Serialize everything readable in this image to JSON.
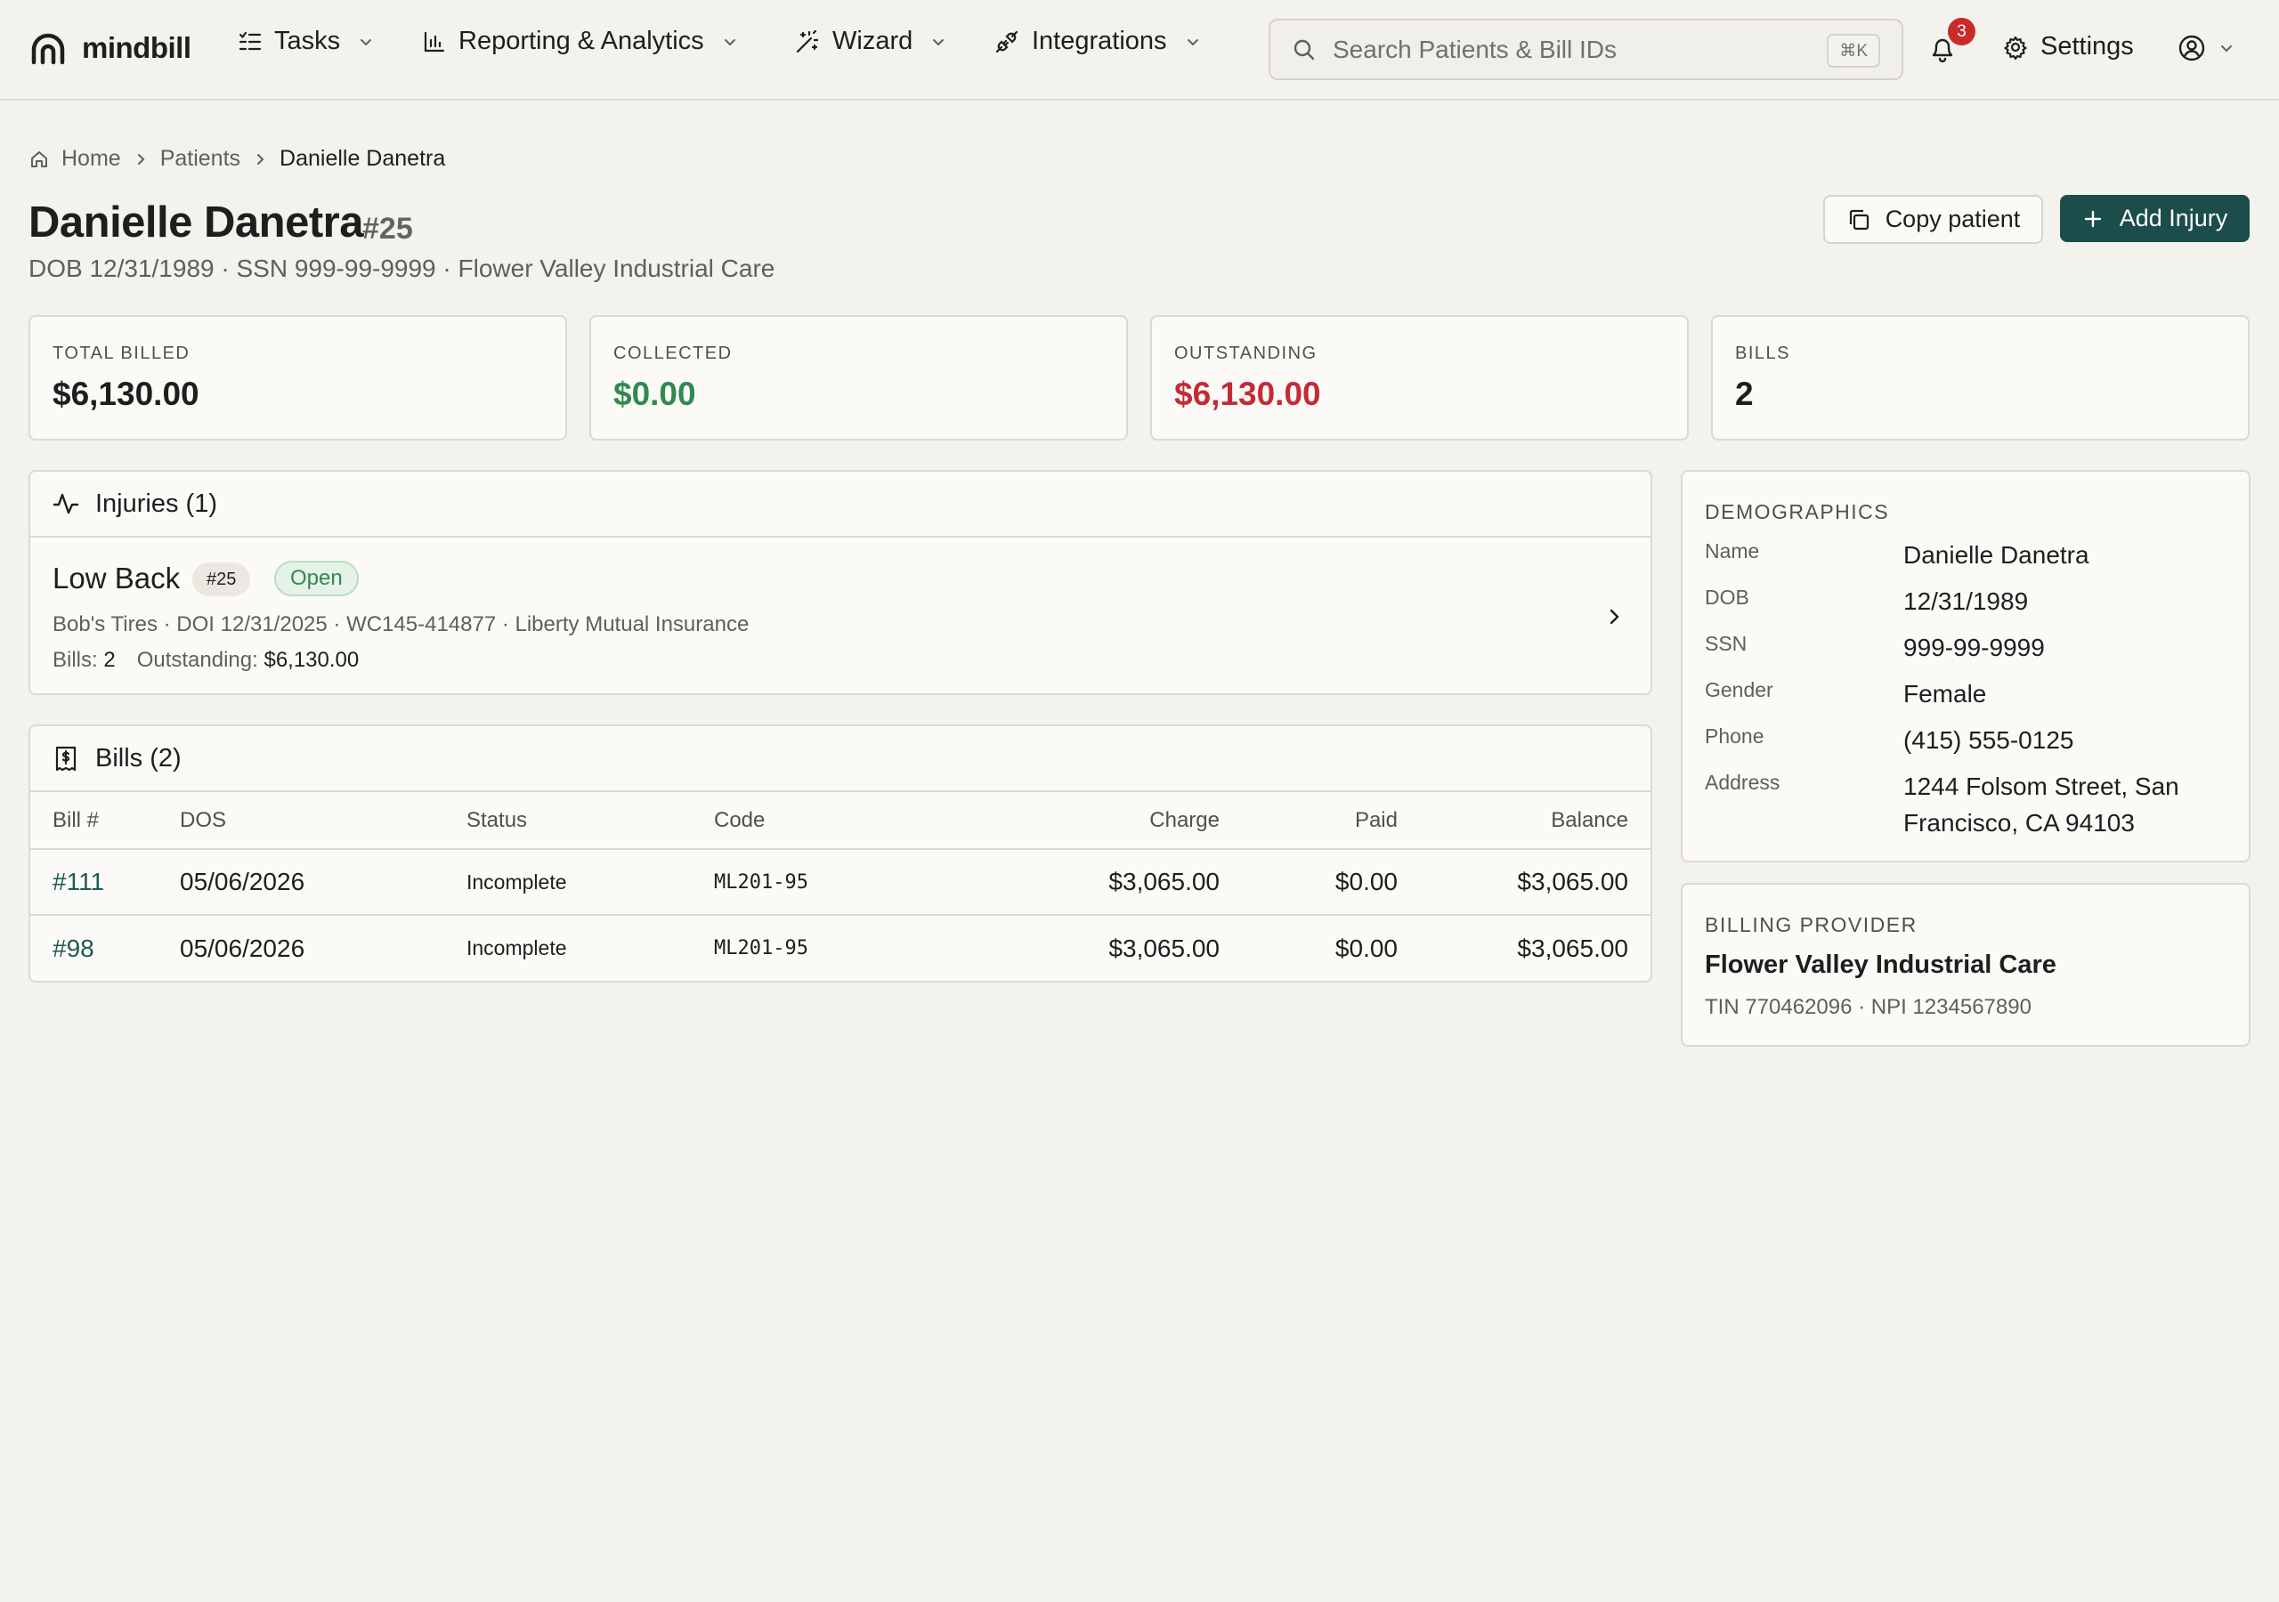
{
  "app": {
    "brand": "mindbill"
  },
  "nav": {
    "items": [
      {
        "label": "Tasks",
        "icon": "tasks-icon"
      },
      {
        "label": "Reporting & Analytics",
        "icon": "bar-chart-icon"
      },
      {
        "label": "Wizard",
        "icon": "wand-icon"
      },
      {
        "label": "Integrations",
        "icon": "plug-icon"
      }
    ],
    "search_placeholder": "Search Patients & Bill IDs",
    "search_shortcut": "⌘K",
    "notification_count": "3",
    "settings_label": "Settings"
  },
  "breadcrumb": {
    "home": "Home",
    "patients": "Patients",
    "current": "Danielle Danetra"
  },
  "header": {
    "name": "Danielle Danetra",
    "id": "#25",
    "subtitle": "DOB 12/31/1989 · SSN 999-99-9999 · Flower Valley Industrial Care",
    "copy_label": "Copy patient",
    "add_label": "Add Injury"
  },
  "stats": [
    {
      "label": "TOTAL BILLED",
      "value": "$6,130.00",
      "color": "#1c1f1e"
    },
    {
      "label": "COLLECTED",
      "value": "$0.00",
      "color": "#2f8a4e"
    },
    {
      "label": "OUTSTANDING",
      "value": "$6,130.00",
      "color": "#c42b35"
    },
    {
      "label": "BILLS",
      "value": "2",
      "color": "#1c1f1e"
    }
  ],
  "injuries": {
    "title": "Injuries (1)",
    "items": [
      {
        "name": "Low Back",
        "id": "#25",
        "status": "Open",
        "meta": "Bob's Tires · DOI 12/31/2025 · WC145-414877 · Liberty Mutual Insurance",
        "bills_label": "Bills:",
        "bills_value": "2",
        "outstanding_label": "Outstanding:",
        "outstanding_value": "$6,130.00"
      }
    ]
  },
  "bills": {
    "title": "Bills (2)",
    "columns": [
      "Bill #",
      "DOS",
      "Status",
      "Code",
      "Charge",
      "Paid",
      "Balance"
    ],
    "rows": [
      {
        "bill": "#111",
        "dos": "05/06/2026",
        "status": "Incomplete",
        "code": "ML201-95",
        "charge": "$3,065.00",
        "paid": "$0.00",
        "balance": "$3,065.00"
      },
      {
        "bill": "#98",
        "dos": "05/06/2026",
        "status": "Incomplete",
        "code": "ML201-95",
        "charge": "$3,065.00",
        "paid": "$0.00",
        "balance": "$3,065.00"
      }
    ]
  },
  "demographics": {
    "title": "DEMOGRAPHICS",
    "fields": [
      {
        "label": "Name",
        "value": "Danielle Danetra"
      },
      {
        "label": "DOB",
        "value": "12/31/1989"
      },
      {
        "label": "SSN",
        "value": "999-99-9999"
      },
      {
        "label": "Gender",
        "value": "Female"
      },
      {
        "label": "Phone",
        "value": "(415) 555-0125"
      },
      {
        "label": "Address",
        "value": "1244 Folsom Street, San Francisco, CA 94103"
      }
    ]
  },
  "billing_provider": {
    "title": "BILLING PROVIDER",
    "name": "Flower Valley Industrial Care",
    "meta": "TIN 770462096 · NPI 1234567890"
  }
}
